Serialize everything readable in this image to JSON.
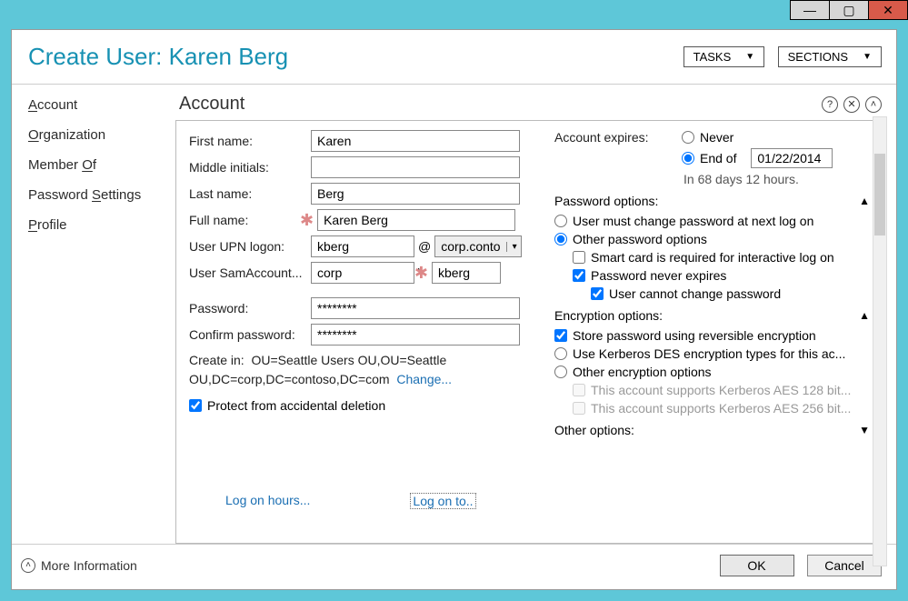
{
  "window": {
    "title": "Create User: Karen Berg",
    "tasks_btn": "TASKS",
    "sections_btn": "SECTIONS"
  },
  "sidebar": {
    "items": [
      "Account",
      "Organization",
      "Member Of",
      "Password Settings",
      "Profile"
    ]
  },
  "section": {
    "title": "Account"
  },
  "labels": {
    "first_name": "First name:",
    "middle_initials": "Middle initials:",
    "last_name": "Last name:",
    "full_name": "Full name:",
    "upn": "User UPN logon:",
    "sam": "User SamAccount...",
    "password": "Password:",
    "confirm": "Confirm password:",
    "createin": "Create in:",
    "change": "Change...",
    "protect": "Protect from accidental deletion",
    "logon_hours": "Log on hours...",
    "logon_to": "Log on to..",
    "acct_expires": "Account expires:",
    "never": "Never",
    "end_of": "End of",
    "expires_in": "In 68 days 12 hours.",
    "pwd_options": "Password options:",
    "must_change": "User must change password at next log on",
    "other_pwd": "Other password options",
    "smartcard": "Smart card is required for interactive log on",
    "never_expire": "Password never expires",
    "cannot_change": "User cannot change password",
    "enc_options": "Encryption options:",
    "reversible": "Store password using reversible encryption",
    "kerb_des": "Use Kerberos DES encryption types for this ac...",
    "other_enc": "Other encryption options",
    "aes128": "This account supports Kerberos AES 128 bit...",
    "aes256": "This account supports Kerberos AES 256 bit...",
    "other_options": "Other options:",
    "more_info": "More Information",
    "ok": "OK",
    "cancel": "Cancel"
  },
  "values": {
    "first_name": "Karen",
    "middle_initials": "",
    "last_name": "Berg",
    "full_name": "Karen Berg",
    "upn": "kberg",
    "upn_domain": "corp.conto",
    "sam_domain": "corp",
    "sam_user": "kberg",
    "password": "********",
    "confirm": "********",
    "createin_path": "OU=Seattle Users OU,OU=Seattle OU,DC=corp,DC=contoso,DC=com",
    "end_date": "01/22/2014"
  },
  "state": {
    "protect": true,
    "expire_never": false,
    "expire_end": true,
    "must_change": false,
    "other_pwd": true,
    "smartcard": false,
    "never_expire": true,
    "cannot_change": true,
    "reversible": true,
    "kerb_des": false,
    "other_enc": false,
    "aes128": false,
    "aes256": false
  }
}
